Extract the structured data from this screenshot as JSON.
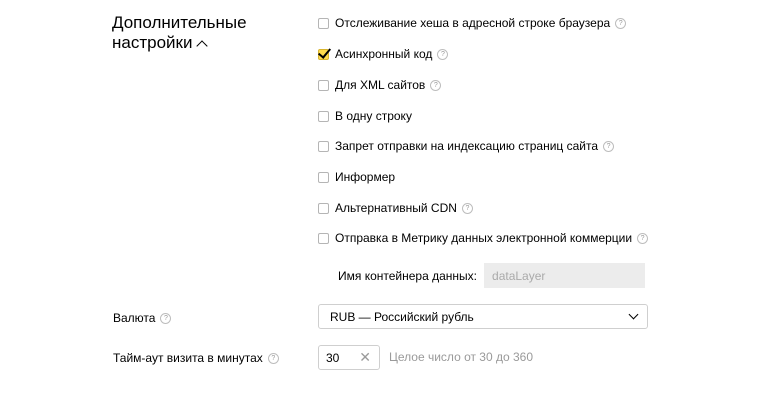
{
  "section": {
    "title_line1": "Дополнительные",
    "title_line2": "настройки"
  },
  "options": [
    {
      "label": "Отслеживание хеша в адресной строке браузера",
      "checked": false,
      "help": true
    },
    {
      "label": "Асинхронный код",
      "checked": true,
      "help": true
    },
    {
      "label": "Для XML сайтов",
      "checked": false,
      "help": true
    },
    {
      "label": "В одну строку",
      "checked": false,
      "help": false
    },
    {
      "label": "Запрет отправки на индексацию страниц сайта",
      "checked": false,
      "help": true
    },
    {
      "label": "Информер",
      "checked": false,
      "help": false
    },
    {
      "label": "Альтернативный CDN",
      "checked": false,
      "help": true
    },
    {
      "label": "Отправка в Метрику данных электронной коммерции",
      "checked": false,
      "help": true
    }
  ],
  "container": {
    "label": "Имя контейнера данных:",
    "placeholder": "dataLayer"
  },
  "currency": {
    "label": "Валюта",
    "value": "RUB — Российский рубль"
  },
  "timeout": {
    "label": "Тайм-аут визита в минутах",
    "value": "30",
    "hint": "Целое число от 30 до 360"
  },
  "icons": {
    "help": "?",
    "clear": "✕"
  }
}
